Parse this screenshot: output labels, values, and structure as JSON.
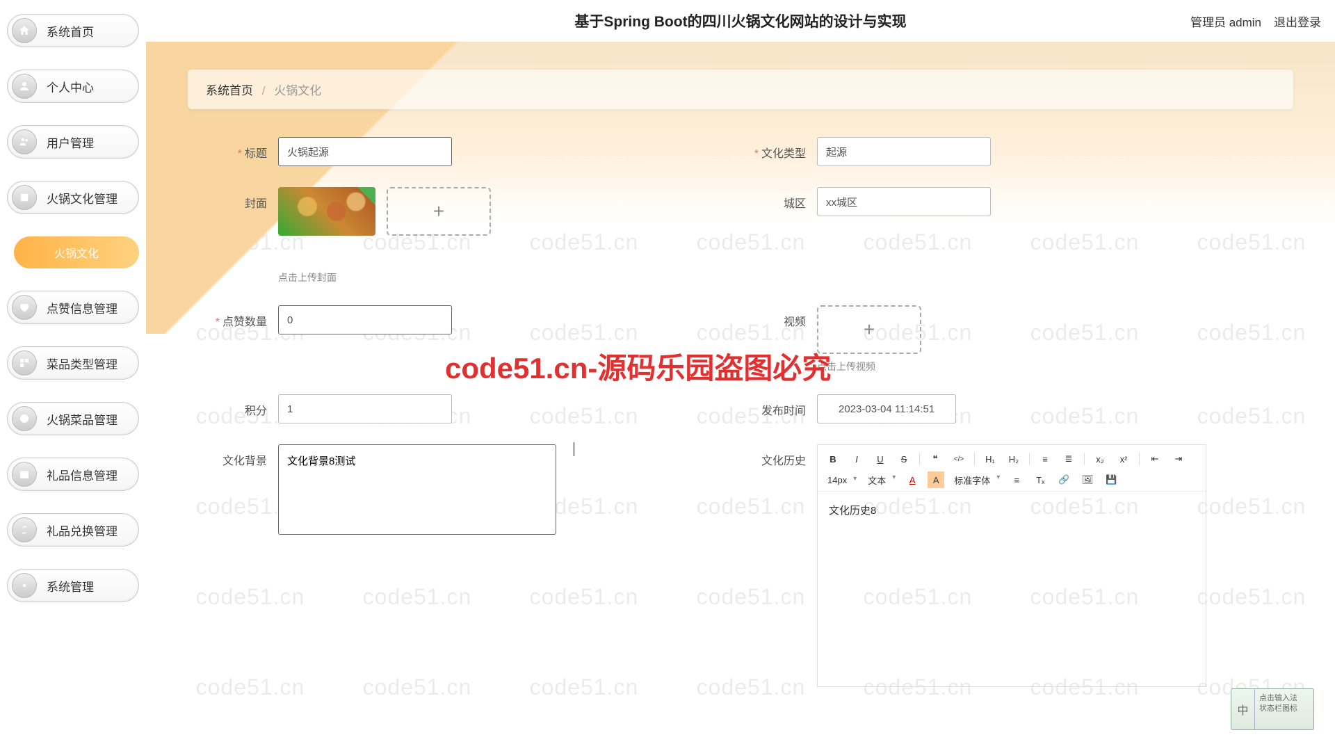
{
  "watermark_text": "code51.cn",
  "big_watermark": "code51.cn-源码乐园盗图必究",
  "header": {
    "title": "基于Spring Boot的四川火锅文化网站的设计与实现",
    "user_label": "管理员 admin",
    "logout": "退出登录"
  },
  "sidebar": {
    "items": [
      {
        "label": "系统首页",
        "icon": "home"
      },
      {
        "label": "个人中心",
        "icon": "user"
      },
      {
        "label": "用户管理",
        "icon": "users"
      },
      {
        "label": "火锅文化管理",
        "icon": "culture"
      },
      {
        "label": "点赞信息管理",
        "icon": "like"
      },
      {
        "label": "菜品类型管理",
        "icon": "category"
      },
      {
        "label": "火锅菜品管理",
        "icon": "dish"
      },
      {
        "label": "礼品信息管理",
        "icon": "gift"
      },
      {
        "label": "礼品兑换管理",
        "icon": "exchange"
      },
      {
        "label": "系统管理",
        "icon": "settings"
      }
    ],
    "active_sub": "火锅文化"
  },
  "breadcrumb": {
    "root": "系统首页",
    "current": "火锅文化"
  },
  "form": {
    "title_label": "标题",
    "title_value": "火锅起源",
    "type_label": "文化类型",
    "type_value": "起源",
    "cover_label": "封面",
    "cover_hint": "点击上传封面",
    "city_label": "城区",
    "city_value": "xx城区",
    "likes_label": "点赞数量",
    "likes_value": "0",
    "video_label": "视频",
    "video_hint": "点击上传视频",
    "points_label": "积分",
    "points_value": "1",
    "publish_label": "发布时间",
    "publish_value": "2023-03-04 11:14:51",
    "bg_label": "文化背景",
    "bg_value": "文化背景8测试",
    "history_label": "文化历史",
    "history_value": "文化历史8"
  },
  "rte": {
    "fontsize": "14px",
    "elem": "文本",
    "font": "标准字体",
    "buttons": {
      "bold": "B",
      "italic": "I",
      "underline": "U",
      "strike": "S",
      "quote": "❝",
      "code": "</>",
      "h1": "H₁",
      "h2": "H₂",
      "ol": "≡",
      "ul": "≣",
      "sub": "x₂",
      "sup": "x²",
      "outdent": "⇤",
      "indent": "⇥",
      "color": "A",
      "bgcolor": "A",
      "align": "≡",
      "clear": "Tₓ",
      "link": "🔗",
      "image": "🖼",
      "save": "💾"
    }
  },
  "ime": {
    "lang": "中",
    "hint1": "点击输入法",
    "hint2": "状态栏图标"
  }
}
